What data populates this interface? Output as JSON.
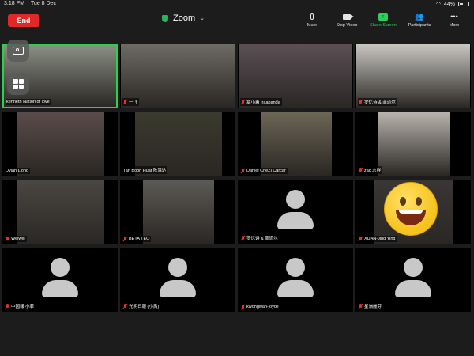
{
  "status_bar": {
    "time": "3:18 PM",
    "date": "Tue 8 Dec",
    "battery": "44%",
    "battery_level": 0.44
  },
  "header": {
    "end_label": "End",
    "title": "Zoom",
    "tools": [
      {
        "label": "Mute",
        "icon": "microphone-icon"
      },
      {
        "label": "Stop Video",
        "icon": "video-camera-icon"
      },
      {
        "label": "Share Screen",
        "icon": "share-screen-icon"
      },
      {
        "label": "Participants",
        "icon": "participants-icon"
      },
      {
        "label": "More",
        "icon": "more-dots-icon"
      }
    ]
  },
  "participants": [
    {
      "name": "kenneth  Nation of love",
      "muted": false,
      "active": true,
      "bg": "#8b8f84"
    },
    {
      "name": "一飞",
      "muted": true,
      "bg": "#6e6a64"
    },
    {
      "name": "章小蕙 Iraapanda",
      "muted": true,
      "bg": "#5b4f55"
    },
    {
      "name": "罗忆诗 & 菲道尔",
      "muted": true,
      "bg": "#c9c6c2"
    },
    {
      "name": "Dylan Liong",
      "muted": false,
      "bg": "#5a4c4a"
    },
    {
      "name": "Tan Boon Huat 陈温达",
      "muted": false,
      "bg": "#3b3a2e"
    },
    {
      "name": "Daniel ChéZi Carcar",
      "muted": true,
      "bg": "#6c6656"
    },
    {
      "name": "zac 志祥",
      "muted": true,
      "bg": "#b9b3ad"
    },
    {
      "name": "Weiwei",
      "muted": true,
      "bg": "#4a4743"
    },
    {
      "name": "BETA TEO",
      "muted": true,
      "bg": "#5c5a55"
    },
    {
      "name": "罗忆诗 & 菲道尔",
      "muted": true,
      "avatar": true
    },
    {
      "name": "XUAN-Jing Ying",
      "muted": true,
      "emoji": true,
      "bg": "#3a3635"
    },
    {
      "name": "中國報 小菲",
      "muted": true,
      "avatar": true
    },
    {
      "name": "光明日報 (小馬)",
      "muted": true,
      "avatar": true
    },
    {
      "name": "kwongwah-joyce",
      "muted": true,
      "avatar": true
    },
    {
      "name": "星洲麗芬",
      "muted": true,
      "avatar": true
    }
  ],
  "floating_controls": [
    {
      "icon": "flip-camera-icon"
    },
    {
      "icon": "gallery-view-icon"
    }
  ],
  "colors": {
    "end": "#e02828",
    "active_border": "#2bd14a",
    "share": "#2bcf5b",
    "mute": "#e53030"
  }
}
